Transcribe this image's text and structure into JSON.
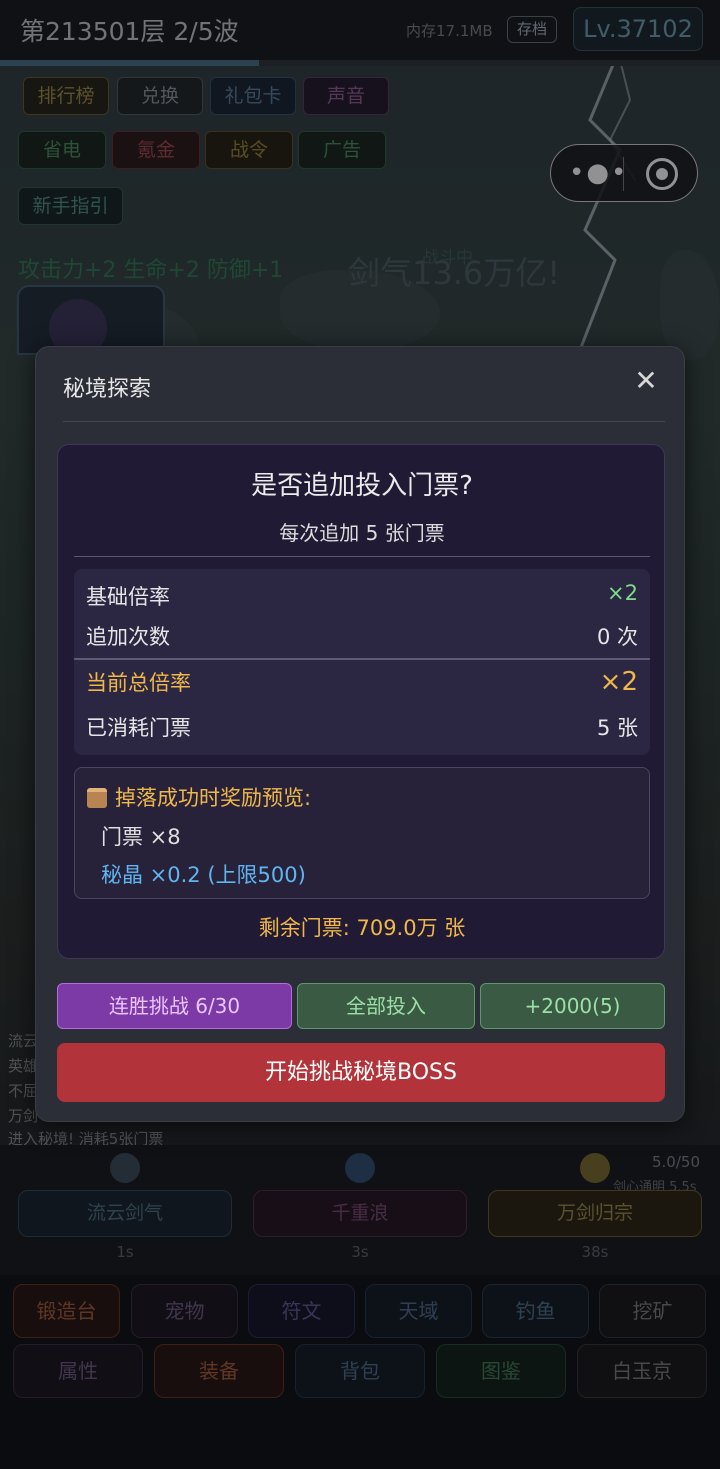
{
  "topbar": {
    "floor_wave": "第213501层  2/5波",
    "memory": "内存17.1MB",
    "save_label": "存档",
    "level": "Lv.37102",
    "progress": 0.36
  },
  "top_menu": {
    "row1": [
      "排行榜",
      "兑换",
      "礼包卡",
      "声音"
    ],
    "row2": [
      "省电",
      "氪金",
      "战令",
      "广告"
    ],
    "row3": [
      "新手指引"
    ]
  },
  "capsule": {
    "more_icon": "more-dots-icon",
    "close_icon": "target-circle-icon"
  },
  "scene": {
    "buff_text": "攻击力+2 生命+2 防御+1",
    "battle_status": "战斗中",
    "sword_qi": "剑气13.6万亿!"
  },
  "log": {
    "lines": [
      "流云",
      "英雄",
      "不屈",
      "万剑"
    ],
    "last_line": "进入秘境! 消耗5张门票"
  },
  "modal": {
    "title": "秘境探索",
    "close_icon": "close-icon",
    "question": "是否追加投入门票?",
    "subtitle": "每次追加 5 张门票",
    "stats": {
      "base_rate_label": "基础倍率",
      "base_rate_value": "×2",
      "add_count_label": "追加次数",
      "add_count_value": "0 次",
      "total_rate_label": "当前总倍率",
      "total_rate_value": "×2",
      "consumed_label": "已消耗门票",
      "consumed_value": "5 张"
    },
    "reward": {
      "title": "掉落成功时奖励预览:",
      "line1": "门票 ×8",
      "line2": "秘晶 ×0.2 (上限500)"
    },
    "remaining": "剩余门票: 709.0万 张",
    "buttons": {
      "streak": "连胜挑战 6/30",
      "all_in": "全部投入",
      "plus": "+2000(5)",
      "start_boss": "开始挑战秘境BOSS"
    }
  },
  "skills": [
    {
      "name": "流云剑气",
      "time": "1s",
      "icon": "wind-slash-icon"
    },
    {
      "name": "千重浪",
      "time": "3s",
      "icon": "wave-icon"
    },
    {
      "name": "万剑归宗",
      "time": "38s",
      "icon": "sword-seal-icon",
      "count": "5.0/50",
      "note": "剑心通明 5.5s"
    }
  ],
  "bottom_nav": {
    "row1": [
      "锻造台",
      "宠物",
      "符文",
      "天域",
      "钓鱼",
      "挖矿"
    ],
    "row2": [
      "属性",
      "装备",
      "背包",
      "图鉴",
      "白玉京"
    ]
  },
  "colors": {
    "accent_gold": "#f0b84a",
    "green": "#7ddc8a",
    "blue_text": "#5fb5f0",
    "boss_red": "#b2343a",
    "streak_purple": "#7b3aa6"
  }
}
